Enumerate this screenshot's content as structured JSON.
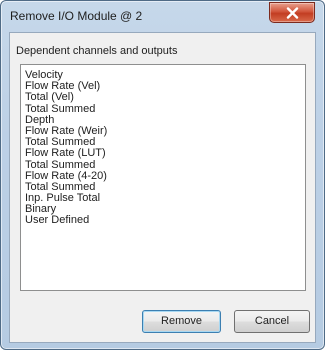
{
  "window": {
    "title": "Remove I/O Module @ 2",
    "close_icon": "close-x-icon",
    "close_color": "#c23d22"
  },
  "dialog": {
    "group_label": "Dependent channels and outputs",
    "items": [
      "Velocity",
      "Flow Rate (Vel)",
      "Total (Vel)",
      "Total Summed",
      "Depth",
      "Flow Rate (Weir)",
      "Total Summed",
      "Flow Rate (LUT)",
      "Total Summed",
      "Flow Rate (4-20)",
      "Total Summed",
      "Inp. Pulse Total",
      "Binary",
      "User Defined"
    ],
    "remove_label": "Remove",
    "cancel_label": "Cancel"
  }
}
